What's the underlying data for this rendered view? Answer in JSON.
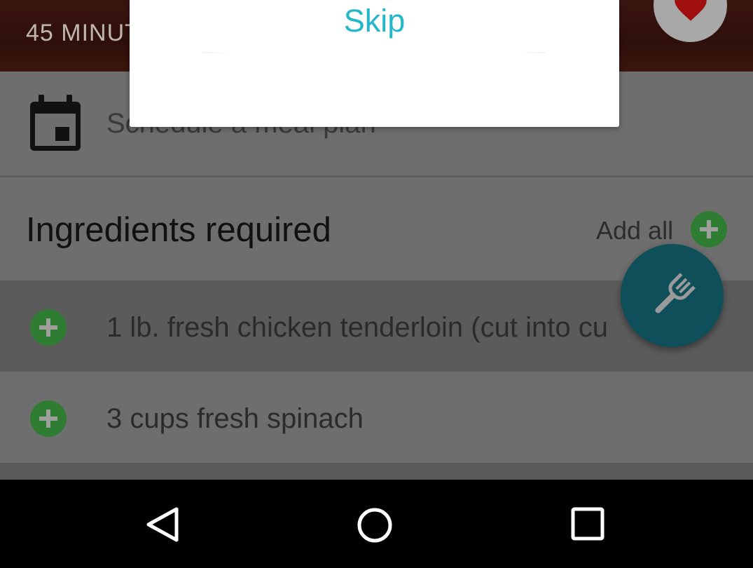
{
  "header": {
    "time_label": "45 MINUT"
  },
  "schedule": {
    "label": "Schedule a meal plan"
  },
  "ingredients": {
    "title": "Ingredients required",
    "add_all_label": "Add all",
    "items": [
      {
        "text": "1 lb. fresh chicken tenderloin (cut into cu"
      },
      {
        "text": "3 cups fresh spinach"
      }
    ]
  },
  "dialog": {
    "skip_label": "Skip"
  },
  "colors": {
    "accent_teal": "#22b7c9",
    "fab": "#0f4f5a",
    "add_green": "#2e7d32",
    "heart": "#a01010"
  },
  "icons": {
    "favorite": "heart-icon",
    "calendar": "calendar-icon",
    "add": "plus-circle-icon",
    "fab": "fork-icon",
    "nav_back": "back-triangle-icon",
    "nav_home": "home-circle-icon",
    "nav_recent": "recent-square-icon"
  }
}
